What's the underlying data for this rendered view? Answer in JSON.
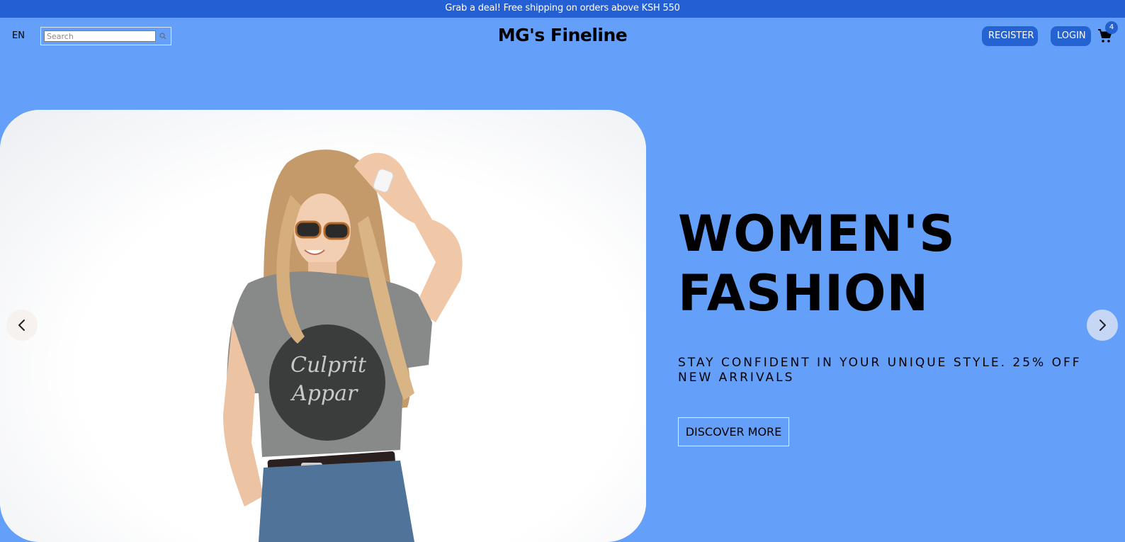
{
  "announcement": {
    "text": "Grab a deal! Free shipping on orders above KSH 550"
  },
  "navbar": {
    "language": "EN",
    "search": {
      "placeholder": "Search",
      "value": ""
    },
    "logo": "MG's Fineline",
    "register_label": "REGISTER",
    "login_label": "LOGIN",
    "cart_count": "4"
  },
  "hero": {
    "title_line1": "WOMEN'S",
    "title_line2": "FASHION",
    "subtitle": "STAY CONFIDENT IN YOUR UNIQUE STYLE. 25% OFF NEW ARRIVALS",
    "cta_label": "DISCOVER MORE",
    "image_tshirt_text_1": "Culprit",
    "image_tshirt_text_2": "Appar"
  },
  "icons": [
    "search-icon",
    "cart-icon",
    "chevron-left-icon",
    "chevron-right-icon"
  ],
  "colors": {
    "page_background": "#64a0fa",
    "announcement_bar": "#2460d4",
    "button": "#2563d2"
  }
}
